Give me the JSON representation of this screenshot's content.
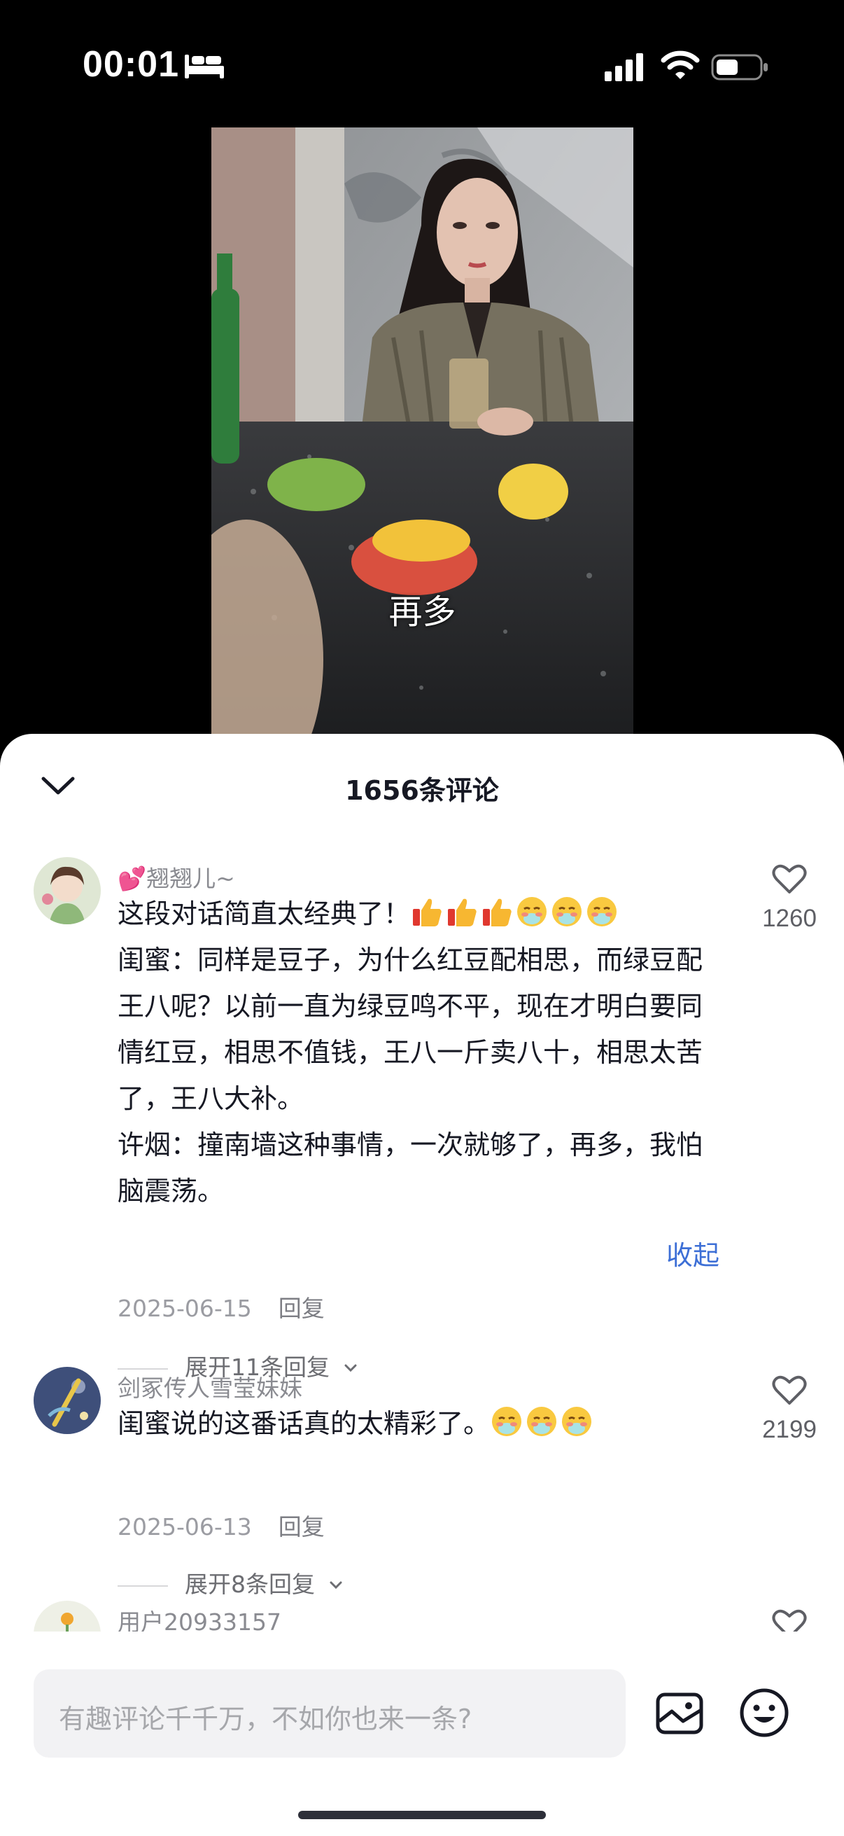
{
  "status_bar": {
    "time": "00:01"
  },
  "video": {
    "subtitle": "再多"
  },
  "comments_panel": {
    "title": "1656条评论",
    "comments": [
      {
        "username": "💕翘翘儿~",
        "text_line1": "这段对话简直太经典了！",
        "paragraph2": "闺蜜：同样是豆子，为什么红豆配相思，而绿豆配王八呢？以前一直为绿豆鸣不平，现在才明白要同情红豆，相思不值钱，王八一斤卖八十，相思太苦了，王八大补。",
        "paragraph3": "许烟：撞南墙这种事情，一次就够了，再多，我怕脑震荡。",
        "fold_label": "收起",
        "date": "2025-06-15",
        "reply_label": "回复",
        "expand_label": "展开11条回复",
        "like_count": "1260"
      },
      {
        "username": "剑冢传人雪莹妹妹",
        "text": "闺蜜说的这番话真的太精彩了。",
        "date": "2025-06-13",
        "reply_label": "回复",
        "expand_label": "展开8条回复",
        "like_count": "2199"
      },
      {
        "username": "用户20933157"
      }
    ]
  },
  "input": {
    "placeholder": "有趣评论千千万，不如你也来一条?"
  },
  "colors": {
    "link": "#3d6fd6",
    "text": "#161823",
    "meta": "#9b9ca2"
  }
}
